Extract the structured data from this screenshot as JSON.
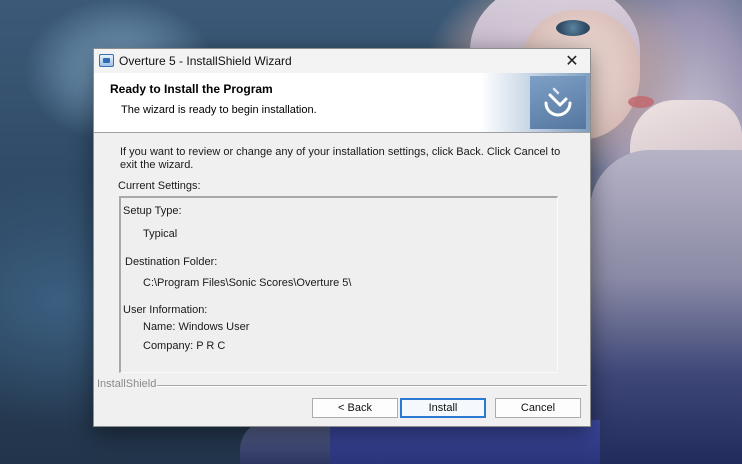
{
  "window": {
    "title": "Overture 5 - InstallShield Wizard",
    "close_glyph": "✕"
  },
  "banner": {
    "title": "Ready to Install the Program",
    "subtitle": "The wizard is ready to begin installation."
  },
  "body": {
    "intro_line1": "If you want to review or change any of your installation settings, click Back. Click Cancel to",
    "intro_line2": "exit the wizard.",
    "settings_label": "Current Settings:"
  },
  "settings": {
    "setup_type_label": "Setup Type:",
    "setup_type_value": "Typical",
    "dest_label": "Destination Folder:",
    "dest_value": "C:\\Program Files\\Sonic Scores\\Overture 5\\",
    "user_label": "User Information:",
    "name_line": "Name: Windows User",
    "company_line": "Company: P R C"
  },
  "footer": {
    "brand": "InstallShield",
    "back_label": "< Back",
    "install_label": "Install",
    "cancel_label": "Cancel"
  },
  "icons": {
    "window_icon": "installer-icon",
    "banner_icon": "installshield-logo"
  },
  "colors": {
    "default_button_border": "#2a7ad1",
    "banner_logo": "#55779f"
  }
}
